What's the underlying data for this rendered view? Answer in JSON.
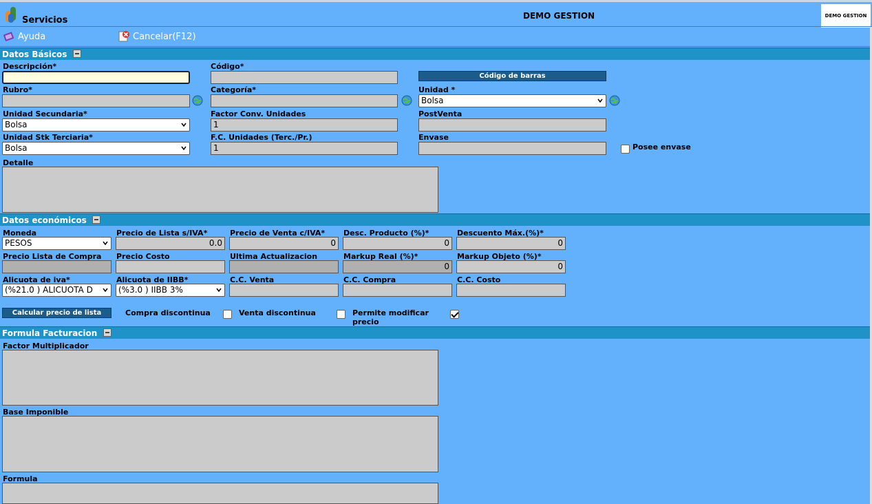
{
  "header": {
    "app_title": "Servicios",
    "center_title": "DEMO GESTION",
    "brand": "DEMO GESTION"
  },
  "toolbar": {
    "help": "Ayuda",
    "cancel": "Cancelar(F12)"
  },
  "sections": {
    "basic": "Datos Básicos",
    "economic": "Datos económicos",
    "formula": "Formula Facturacion"
  },
  "basic": {
    "descripcion_label": "Descripción*",
    "descripcion_value": "",
    "codigo_label": "Código*",
    "codigo_value": "",
    "barcode_button": "Código de barras",
    "rubro_label": "Rubro*",
    "rubro_value": "",
    "categoria_label": "Categoría*",
    "categoria_value": "",
    "unidad_label": "Unidad *",
    "unidad_value": "Bolsa",
    "unidad_sec_label": "Unidad Secundaria*",
    "unidad_sec_value": "Bolsa",
    "factor_conv_label": "Factor Conv. Unidades",
    "factor_conv_value": "1",
    "postventa_label": "PostVenta",
    "postventa_value": "",
    "unidad_terc_label": "Unidad Stk Terciaria*",
    "unidad_terc_value": "Bolsa",
    "fc_unidades_label": "F.C. Unidades (Terc./Pr.)",
    "fc_unidades_value": "1",
    "envase_label": "Envase",
    "envase_value": "",
    "posee_envase_label": "Posee envase",
    "detalle_label": "Detalle"
  },
  "economic": {
    "moneda_label": "Moneda",
    "moneda_value": "PESOS",
    "precio_lista_label": "Precio de Lista s/IVA*",
    "precio_lista_value": "0.0",
    "precio_venta_label": "Precio de Venta c/IVA*",
    "precio_venta_value": "0",
    "desc_producto_label": "Desc. Producto (%)*",
    "desc_producto_value": "0",
    "descuento_max_label": "Descuento Máx.(%)*",
    "descuento_max_value": "0",
    "precio_compra_label": "Precio Lista de Compra",
    "precio_costo_label": "Precio Costo",
    "ultima_act_label": "Ultima Actualizacion",
    "markup_real_label": "Markup Real (%)*",
    "markup_real_value": "0",
    "markup_obj_label": "Markup Objeto (%)*",
    "markup_obj_value": "0",
    "alicuota_iva_label": "Alicuota de iva*",
    "alicuota_iva_value": "(%21.0 ) ALICUOTA D",
    "alicuota_iibb_label": "Alicuota de IIBB*",
    "alicuota_iibb_value": "(%3.0 ) IIBB 3%",
    "cc_venta_label": "C.C. Venta",
    "cc_compra_label": "C.C. Compra",
    "cc_costo_label": "C.C. Costo",
    "calc_button": "Calcular precio de lista",
    "compra_disc_label": "Compra discontinua",
    "venta_disc_label": "Venta discontinua",
    "permite_mod_label_1": "Permite modificar",
    "permite_mod_label_2": "precio"
  },
  "formula": {
    "factor_label": "Factor Multiplicador",
    "base_label": "Base Imponible",
    "formula_label": "Formula"
  }
}
